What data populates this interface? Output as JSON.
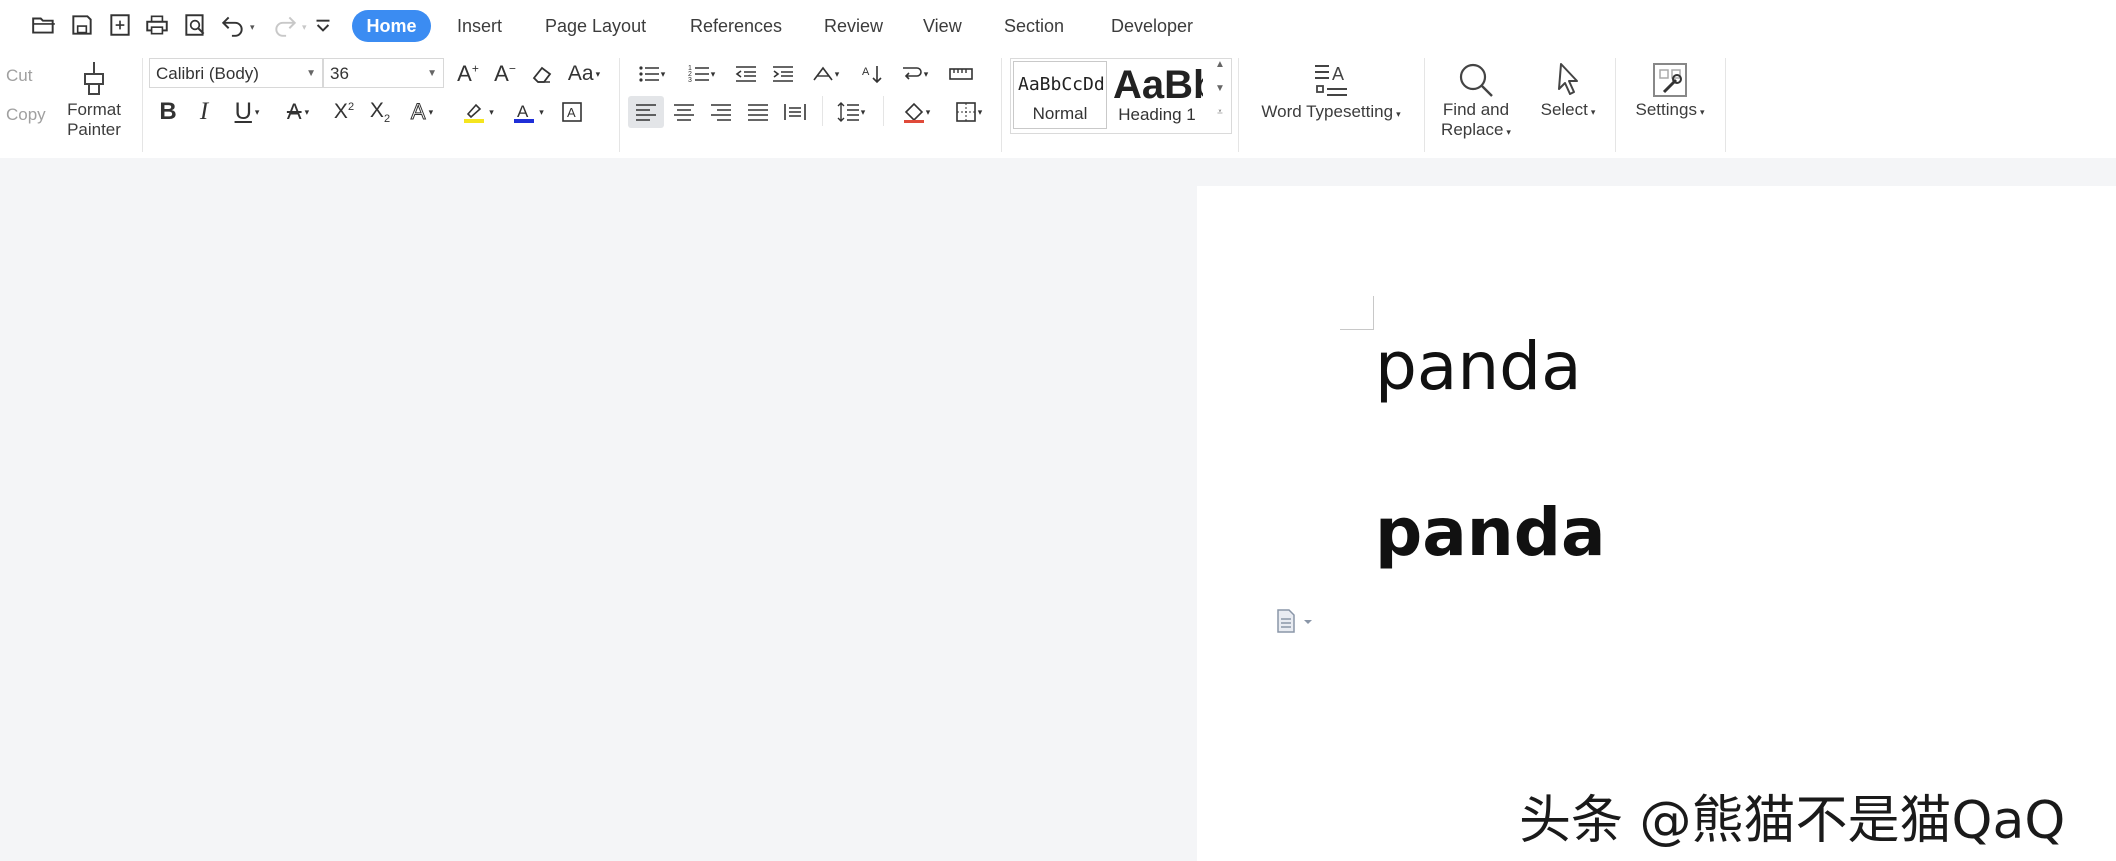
{
  "quick_access": {
    "icons": [
      "open-folder-icon",
      "save-icon",
      "export-pdf-icon",
      "print-icon",
      "print-preview-icon",
      "undo-icon",
      "redo-icon",
      "customize-icon"
    ]
  },
  "menu": {
    "tabs": [
      {
        "label": "Home",
        "active": true
      },
      {
        "label": "Insert"
      },
      {
        "label": "Page Layout"
      },
      {
        "label": "References"
      },
      {
        "label": "Review"
      },
      {
        "label": "View"
      },
      {
        "label": "Section"
      },
      {
        "label": "Developer"
      }
    ]
  },
  "clipboard": {
    "cut": "Cut",
    "copy": "Copy",
    "format_painter": [
      "Format",
      "Painter"
    ]
  },
  "font": {
    "name": "Calibri (Body)",
    "size": "36"
  },
  "styles": {
    "normal_preview": "AaBbCcDd",
    "normal_label": "Normal",
    "heading_preview": "AaBb",
    "heading_label": "Heading 1"
  },
  "tools": {
    "word_typesetting": "Word Typesetting",
    "find_replace": [
      "Find and",
      "Replace"
    ],
    "select": "Select",
    "settings": "Settings"
  },
  "document": {
    "line1": "panda",
    "line2": "panda"
  },
  "watermark": "头条 @熊猫不是猫QaQ",
  "colors": {
    "accent": "#3b8cf2",
    "highlight": "#f5e51f",
    "font_color": "#1f2fd8"
  }
}
